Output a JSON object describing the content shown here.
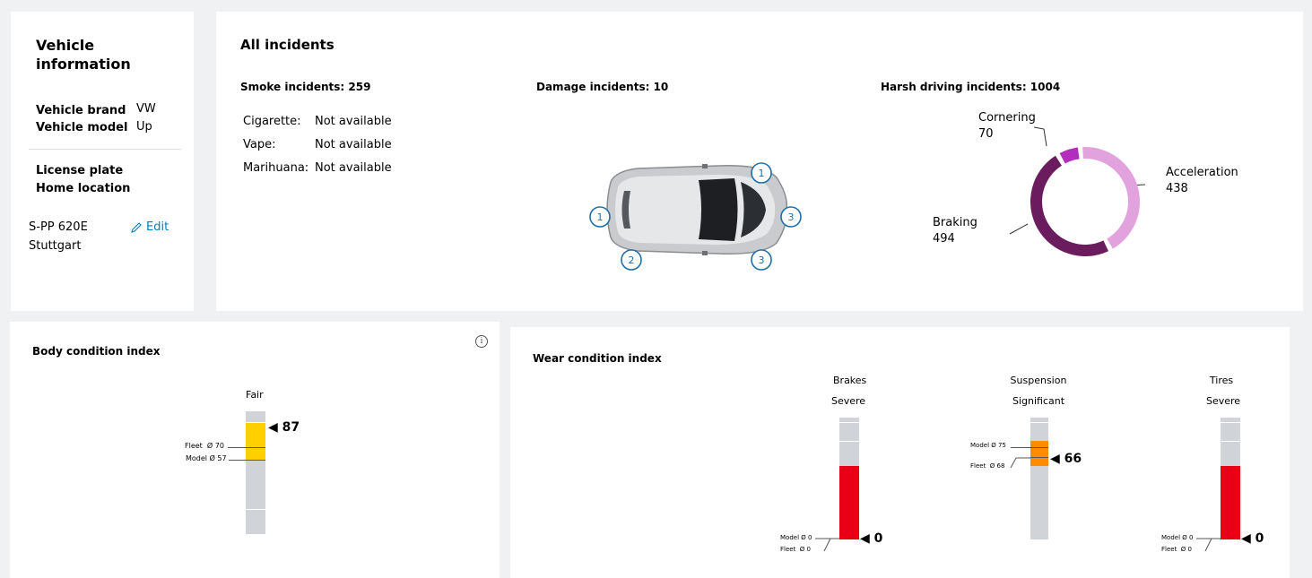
{
  "vehicle_info": {
    "title_line1": "Vehicle",
    "title_line2": "information",
    "brand_label": "Vehicle brand",
    "brand_value": "VW",
    "model_label": "Vehicle model",
    "model_value": "Up",
    "plate_label": "License plate",
    "location_label": "Home location",
    "plate_value": "S-PP 620E",
    "location_value": "Stuttgart",
    "edit_label": "Edit",
    "edit_icon": "pencil-icon"
  },
  "incidents": {
    "title": "All incidents",
    "smoke": {
      "title": "Smoke incidents: 259",
      "rows": [
        {
          "label": "Cigarette:",
          "value": "Not available"
        },
        {
          "label": "Vape:",
          "value": "Not available"
        },
        {
          "label": "Marihuana:",
          "value": "Not available"
        }
      ]
    },
    "damage": {
      "title": "Damage incidents: 10",
      "markers": [
        "1",
        "1",
        "2",
        "3",
        "3"
      ]
    },
    "harsh": {
      "title": "Harsh driving incidents: 1004",
      "segments": [
        {
          "name": "Cornering",
          "value": "70",
          "color": "#b22fbe"
        },
        {
          "name": "Acceleration",
          "value": "438",
          "color": "#e2a2de"
        },
        {
          "name": "Braking",
          "value": "494",
          "color": "#6a1c5e"
        }
      ]
    }
  },
  "body_condition": {
    "title": "Body condition index",
    "status": "Fair",
    "value": "87",
    "value_fraction": 0.87,
    "fill_color": "#ffcf00",
    "fleet_label": "Fleet  Ø 70",
    "model_label": "Model Ø 57",
    "info_icon": "info-icon"
  },
  "wear_condition": {
    "title": "Wear condition index",
    "items": [
      {
        "name": "Brakes",
        "status": "Severe",
        "value": "0",
        "model_label": "Model Ø 0",
        "fleet_label": "Fleet  Ø 0",
        "color": "#ea0016"
      },
      {
        "name": "Suspension",
        "status": "Significant",
        "value": "66",
        "model_label": "Model Ø 75",
        "fleet_label": "Fleet  Ø 68",
        "color": "#ff8b00"
      },
      {
        "name": "Tires",
        "status": "Severe",
        "value": "0",
        "model_label": "Model Ø 0",
        "fleet_label": "Fleet  Ø 0",
        "color": "#ea0016"
      }
    ]
  }
}
